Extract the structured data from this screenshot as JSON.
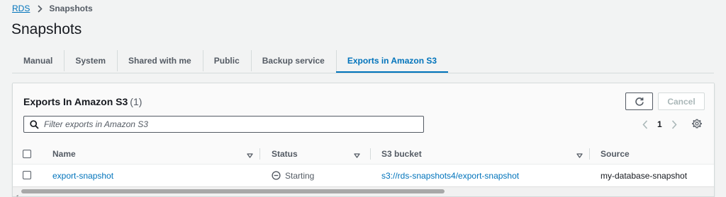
{
  "breadcrumb": {
    "root": "RDS",
    "current": "Snapshots"
  },
  "page": {
    "title": "Snapshots"
  },
  "tabs": [
    {
      "label": "Manual"
    },
    {
      "label": "System"
    },
    {
      "label": "Shared with me"
    },
    {
      "label": "Public"
    },
    {
      "label": "Backup service"
    },
    {
      "label": "Exports in Amazon S3",
      "active": true
    }
  ],
  "panel": {
    "title": "Exports In Amazon S3",
    "count": "(1)",
    "cancel_label": "Cancel",
    "refresh_icon": "refresh-icon",
    "filter_placeholder": "Filter exports in Amazon S3",
    "filter_value": "",
    "pagination": {
      "page": "1"
    }
  },
  "table": {
    "columns": [
      "Name",
      "Status",
      "S3 bucket",
      "Source"
    ],
    "rows": [
      {
        "name": "export-snapshot",
        "status": "Starting",
        "bucket": "s3://rds-snapshots4/export-snapshot",
        "source": "my-database-snapshot"
      }
    ]
  },
  "colors": {
    "accent": "#0073bb",
    "border": "#d5dbdb",
    "text": "#16191f",
    "secondary_text": "#545b64",
    "background": "#f2f3f3"
  }
}
